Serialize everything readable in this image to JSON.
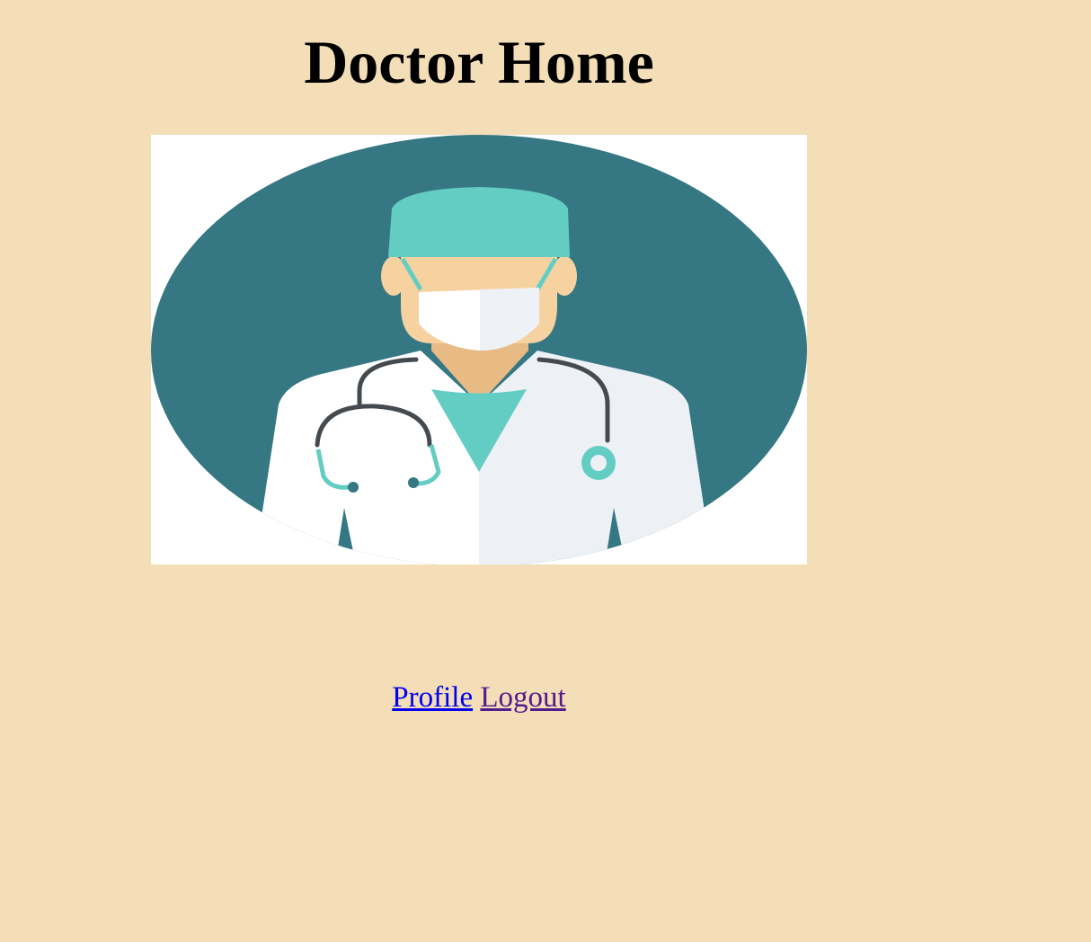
{
  "page": {
    "title": "Doctor Home",
    "background_color": "#f3deb8"
  },
  "illustration": {
    "icon": "doctor-avatar-icon",
    "colors": {
      "circle": "#357783",
      "cap": "#63cdc4",
      "skin": "#f6d2a1",
      "neck": "#e8bb85",
      "mask": "#ffffff",
      "coat_left": "#ffffff",
      "coat_right": "#edf1f6",
      "scrubs": "#63cdc4",
      "stethoscope": "#454a4f"
    }
  },
  "nav": {
    "profile_label": "Profile",
    "logout_label": "Logout",
    "link_color": "#0000ee",
    "visited_link_color": "#551a8b"
  }
}
